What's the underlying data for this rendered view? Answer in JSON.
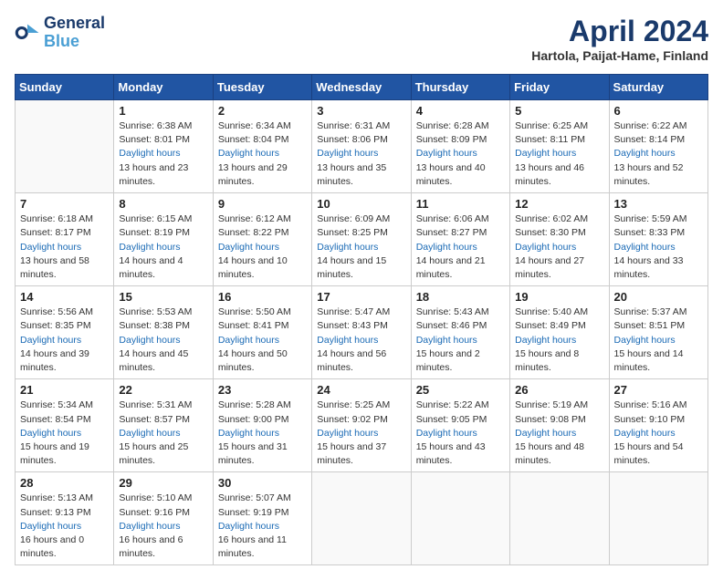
{
  "header": {
    "logo_line1": "General",
    "logo_line2": "Blue",
    "month": "April 2024",
    "location": "Hartola, Paijat-Hame, Finland"
  },
  "weekdays": [
    "Sunday",
    "Monday",
    "Tuesday",
    "Wednesday",
    "Thursday",
    "Friday",
    "Saturday"
  ],
  "weeks": [
    [
      {
        "day": "",
        "empty": true
      },
      {
        "day": "1",
        "sunrise": "6:38 AM",
        "sunset": "8:01 PM",
        "daylight": "13 hours and 23 minutes."
      },
      {
        "day": "2",
        "sunrise": "6:34 AM",
        "sunset": "8:04 PM",
        "daylight": "13 hours and 29 minutes."
      },
      {
        "day": "3",
        "sunrise": "6:31 AM",
        "sunset": "8:06 PM",
        "daylight": "13 hours and 35 minutes."
      },
      {
        "day": "4",
        "sunrise": "6:28 AM",
        "sunset": "8:09 PM",
        "daylight": "13 hours and 40 minutes."
      },
      {
        "day": "5",
        "sunrise": "6:25 AM",
        "sunset": "8:11 PM",
        "daylight": "13 hours and 46 minutes."
      },
      {
        "day": "6",
        "sunrise": "6:22 AM",
        "sunset": "8:14 PM",
        "daylight": "13 hours and 52 minutes."
      }
    ],
    [
      {
        "day": "7",
        "sunrise": "6:18 AM",
        "sunset": "8:17 PM",
        "daylight": "13 hours and 58 minutes."
      },
      {
        "day": "8",
        "sunrise": "6:15 AM",
        "sunset": "8:19 PM",
        "daylight": "14 hours and 4 minutes."
      },
      {
        "day": "9",
        "sunrise": "6:12 AM",
        "sunset": "8:22 PM",
        "daylight": "14 hours and 10 minutes."
      },
      {
        "day": "10",
        "sunrise": "6:09 AM",
        "sunset": "8:25 PM",
        "daylight": "14 hours and 15 minutes."
      },
      {
        "day": "11",
        "sunrise": "6:06 AM",
        "sunset": "8:27 PM",
        "daylight": "14 hours and 21 minutes."
      },
      {
        "day": "12",
        "sunrise": "6:02 AM",
        "sunset": "8:30 PM",
        "daylight": "14 hours and 27 minutes."
      },
      {
        "day": "13",
        "sunrise": "5:59 AM",
        "sunset": "8:33 PM",
        "daylight": "14 hours and 33 minutes."
      }
    ],
    [
      {
        "day": "14",
        "sunrise": "5:56 AM",
        "sunset": "8:35 PM",
        "daylight": "14 hours and 39 minutes."
      },
      {
        "day": "15",
        "sunrise": "5:53 AM",
        "sunset": "8:38 PM",
        "daylight": "14 hours and 45 minutes."
      },
      {
        "day": "16",
        "sunrise": "5:50 AM",
        "sunset": "8:41 PM",
        "daylight": "14 hours and 50 minutes."
      },
      {
        "day": "17",
        "sunrise": "5:47 AM",
        "sunset": "8:43 PM",
        "daylight": "14 hours and 56 minutes."
      },
      {
        "day": "18",
        "sunrise": "5:43 AM",
        "sunset": "8:46 PM",
        "daylight": "15 hours and 2 minutes."
      },
      {
        "day": "19",
        "sunrise": "5:40 AM",
        "sunset": "8:49 PM",
        "daylight": "15 hours and 8 minutes."
      },
      {
        "day": "20",
        "sunrise": "5:37 AM",
        "sunset": "8:51 PM",
        "daylight": "15 hours and 14 minutes."
      }
    ],
    [
      {
        "day": "21",
        "sunrise": "5:34 AM",
        "sunset": "8:54 PM",
        "daylight": "15 hours and 19 minutes."
      },
      {
        "day": "22",
        "sunrise": "5:31 AM",
        "sunset": "8:57 PM",
        "daylight": "15 hours and 25 minutes."
      },
      {
        "day": "23",
        "sunrise": "5:28 AM",
        "sunset": "9:00 PM",
        "daylight": "15 hours and 31 minutes."
      },
      {
        "day": "24",
        "sunrise": "5:25 AM",
        "sunset": "9:02 PM",
        "daylight": "15 hours and 37 minutes."
      },
      {
        "day": "25",
        "sunrise": "5:22 AM",
        "sunset": "9:05 PM",
        "daylight": "15 hours and 43 minutes."
      },
      {
        "day": "26",
        "sunrise": "5:19 AM",
        "sunset": "9:08 PM",
        "daylight": "15 hours and 48 minutes."
      },
      {
        "day": "27",
        "sunrise": "5:16 AM",
        "sunset": "9:10 PM",
        "daylight": "15 hours and 54 minutes."
      }
    ],
    [
      {
        "day": "28",
        "sunrise": "5:13 AM",
        "sunset": "9:13 PM",
        "daylight": "16 hours and 0 minutes."
      },
      {
        "day": "29",
        "sunrise": "5:10 AM",
        "sunset": "9:16 PM",
        "daylight": "16 hours and 6 minutes."
      },
      {
        "day": "30",
        "sunrise": "5:07 AM",
        "sunset": "9:19 PM",
        "daylight": "16 hours and 11 minutes."
      },
      {
        "day": "",
        "empty": true
      },
      {
        "day": "",
        "empty": true
      },
      {
        "day": "",
        "empty": true
      },
      {
        "day": "",
        "empty": true
      }
    ]
  ]
}
